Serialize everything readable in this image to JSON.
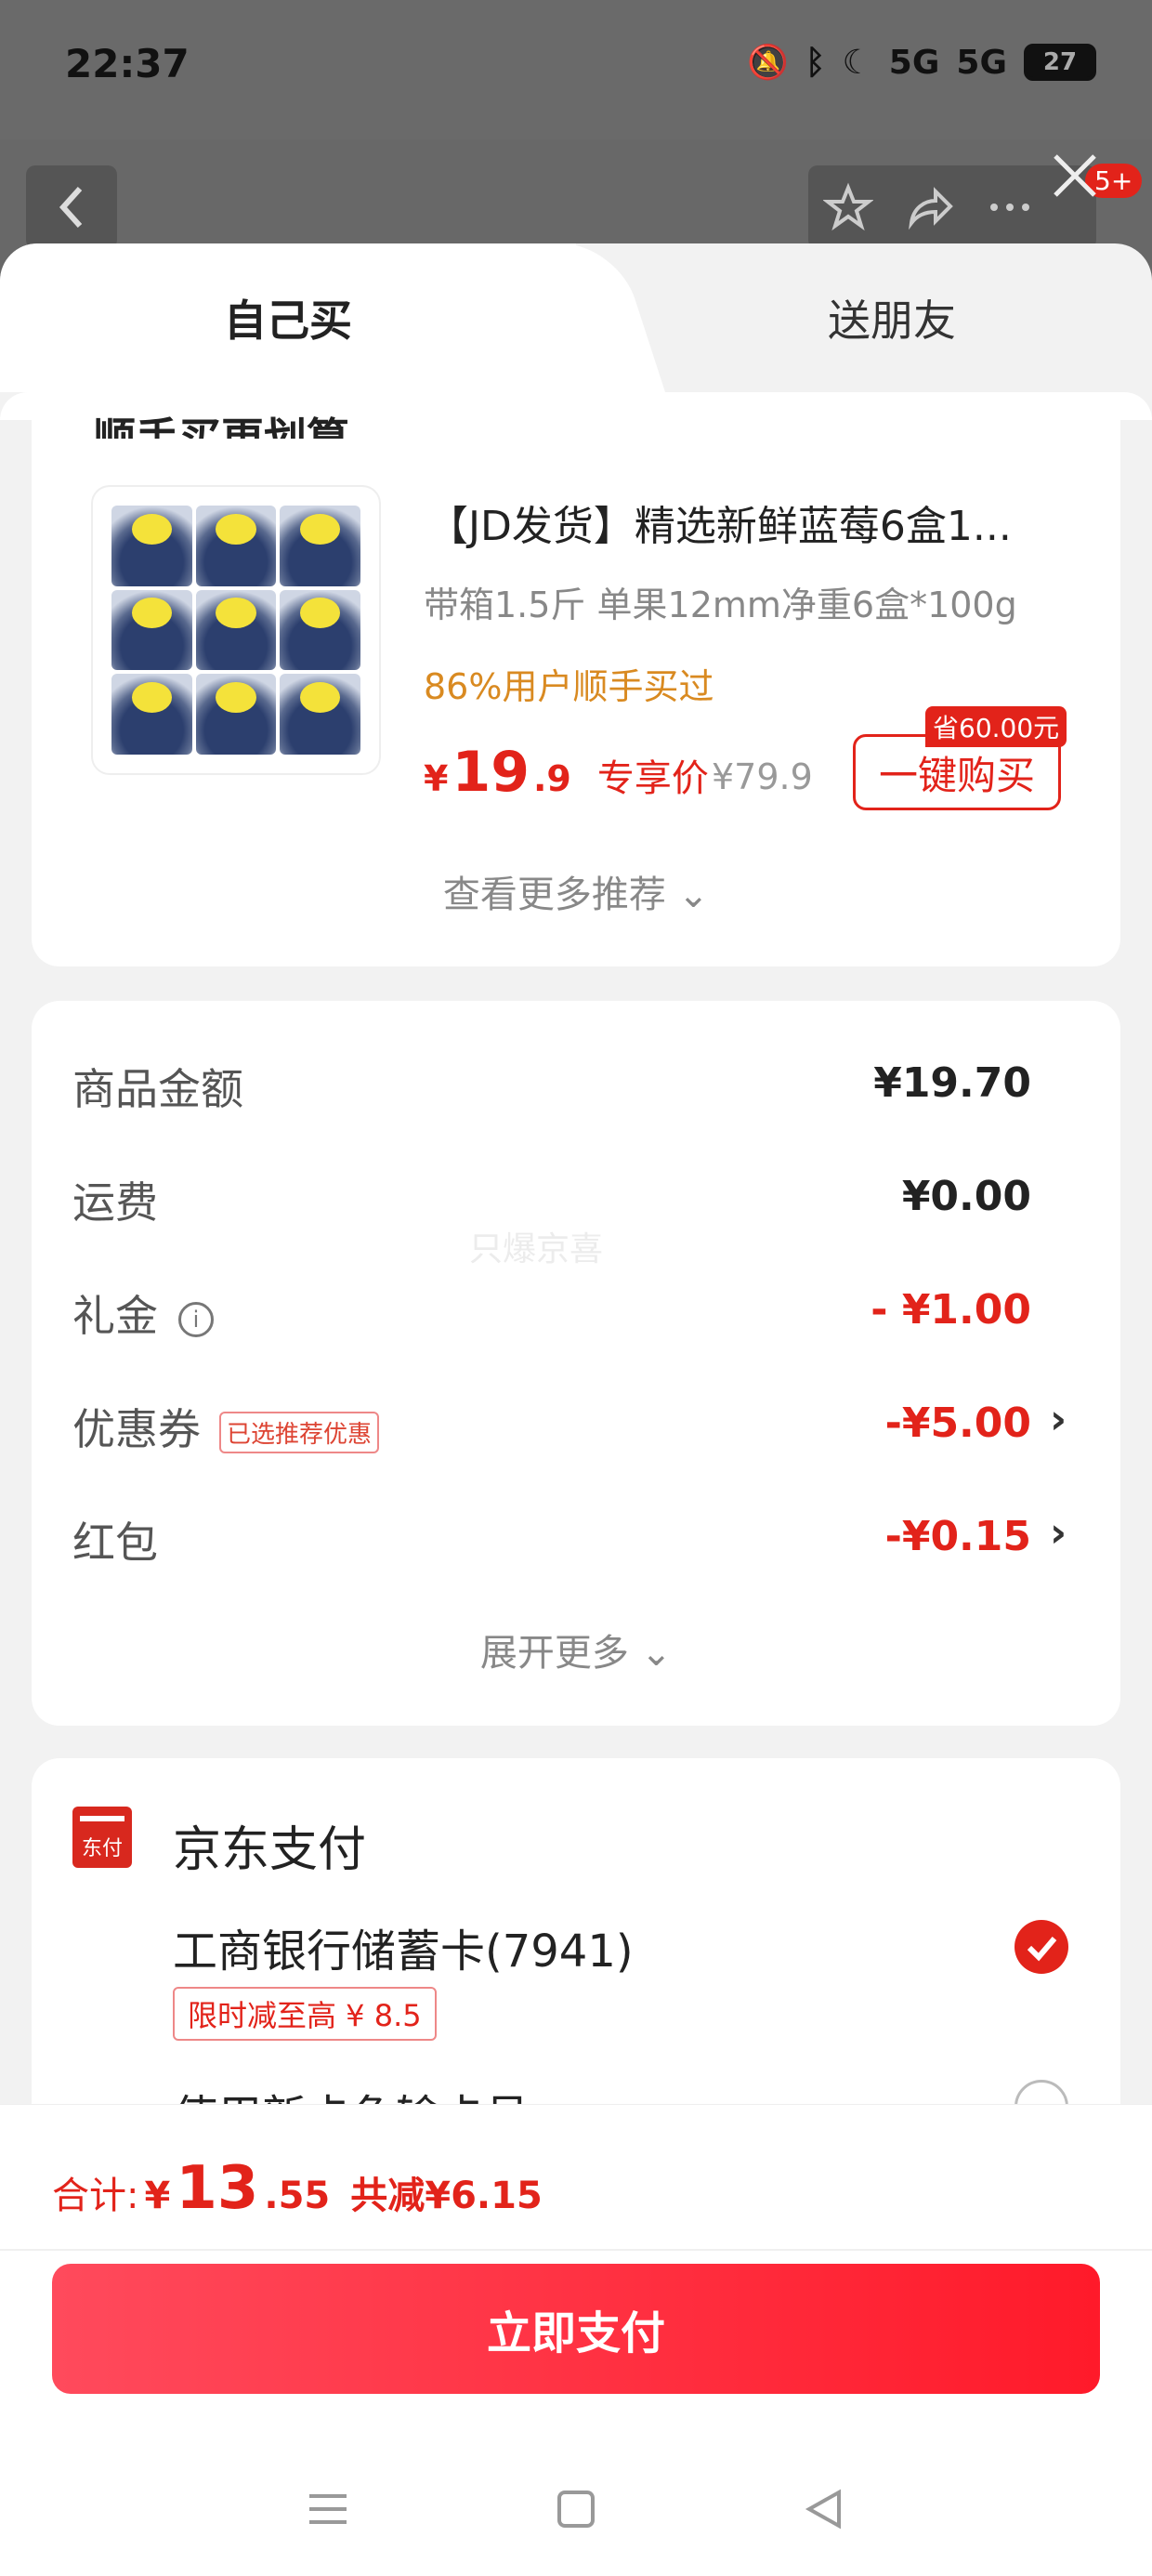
{
  "status_bar": {
    "time": "22:37",
    "net1": "5G",
    "net2": "5G",
    "battery": "27"
  },
  "sheet_tabs": {
    "self_buy": "自己买",
    "gift": "送朋友"
  },
  "recommend": {
    "section_title": "顺手买更划算",
    "product_title": "【JD发货】精选新鲜蓝莓6盒1...",
    "spec": "带箱1.5斤 单果12mm净重6盒*100g",
    "rate": "86%用户顺手买过",
    "price_currency": "¥",
    "price_int": "19",
    "price_dec": ".9",
    "price_tag": "专享价",
    "old_price": "¥79.9",
    "save_tag": "省60.00元",
    "buy_button": "一键购买",
    "more": "查看更多推荐 ⌄"
  },
  "summary": {
    "rows": [
      {
        "label": "商品金额",
        "value": "¥19.70"
      },
      {
        "label": "运费",
        "value": "¥0.00"
      },
      {
        "label": "礼金",
        "value": "- ¥1.00"
      },
      {
        "label": "优惠券",
        "value": "-¥5.00",
        "tag": "已选推荐优惠"
      },
      {
        "label": "红包",
        "value": "-¥0.15"
      }
    ],
    "watermark": "只爆京喜",
    "expand": "展开更多 ⌄"
  },
  "payment": {
    "icon_text": "东付",
    "title": "京东支付",
    "bank": "工商银行储蓄卡(7941)",
    "limit_tag": "限时减至高 ¥ 8.5",
    "next_option": "使用新卡免输卡号"
  },
  "footer": {
    "total_label": "合计:",
    "total_currency": "¥",
    "total_int": "13",
    "total_dec": ".55",
    "saved": "共减¥6.15",
    "pay_button": "立即支付"
  },
  "colors": {
    "accent": "#e2231a",
    "pay_gradient_start": "#ff4a5c",
    "pay_gradient_end": "#ff1a2a"
  }
}
